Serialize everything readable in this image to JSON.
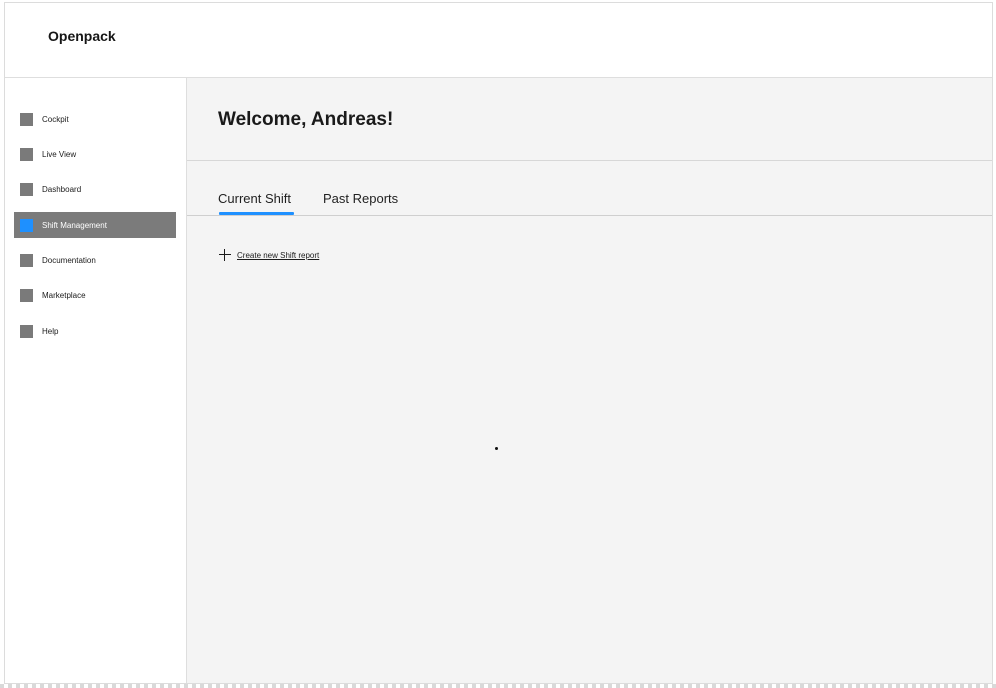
{
  "app": {
    "brand": "Openpack"
  },
  "sidebar": {
    "items": [
      {
        "label": "Cockpit",
        "icon": "square-icon",
        "active": false
      },
      {
        "label": "Live View",
        "icon": "square-icon",
        "active": false
      },
      {
        "label": "Dashboard",
        "icon": "square-icon",
        "active": false
      },
      {
        "label": "Shift Management",
        "icon": "square-icon",
        "active": true
      },
      {
        "label": "Documentation",
        "icon": "square-icon",
        "active": false
      },
      {
        "label": "Marketplace",
        "icon": "square-icon",
        "active": false
      },
      {
        "label": "Help",
        "icon": "square-icon",
        "active": false
      }
    ]
  },
  "main": {
    "welcome": "Welcome, Andreas!",
    "tabs": [
      {
        "label": "Current Shift",
        "selected": true
      },
      {
        "label": "Past Reports",
        "selected": false
      }
    ],
    "create_action": "Create new Shift report"
  },
  "colors": {
    "accent": "#1e90ff",
    "active_item_bg": "#7b7b7b",
    "icon_square": "#7a7a7a",
    "main_bg": "#f4f4f4"
  }
}
